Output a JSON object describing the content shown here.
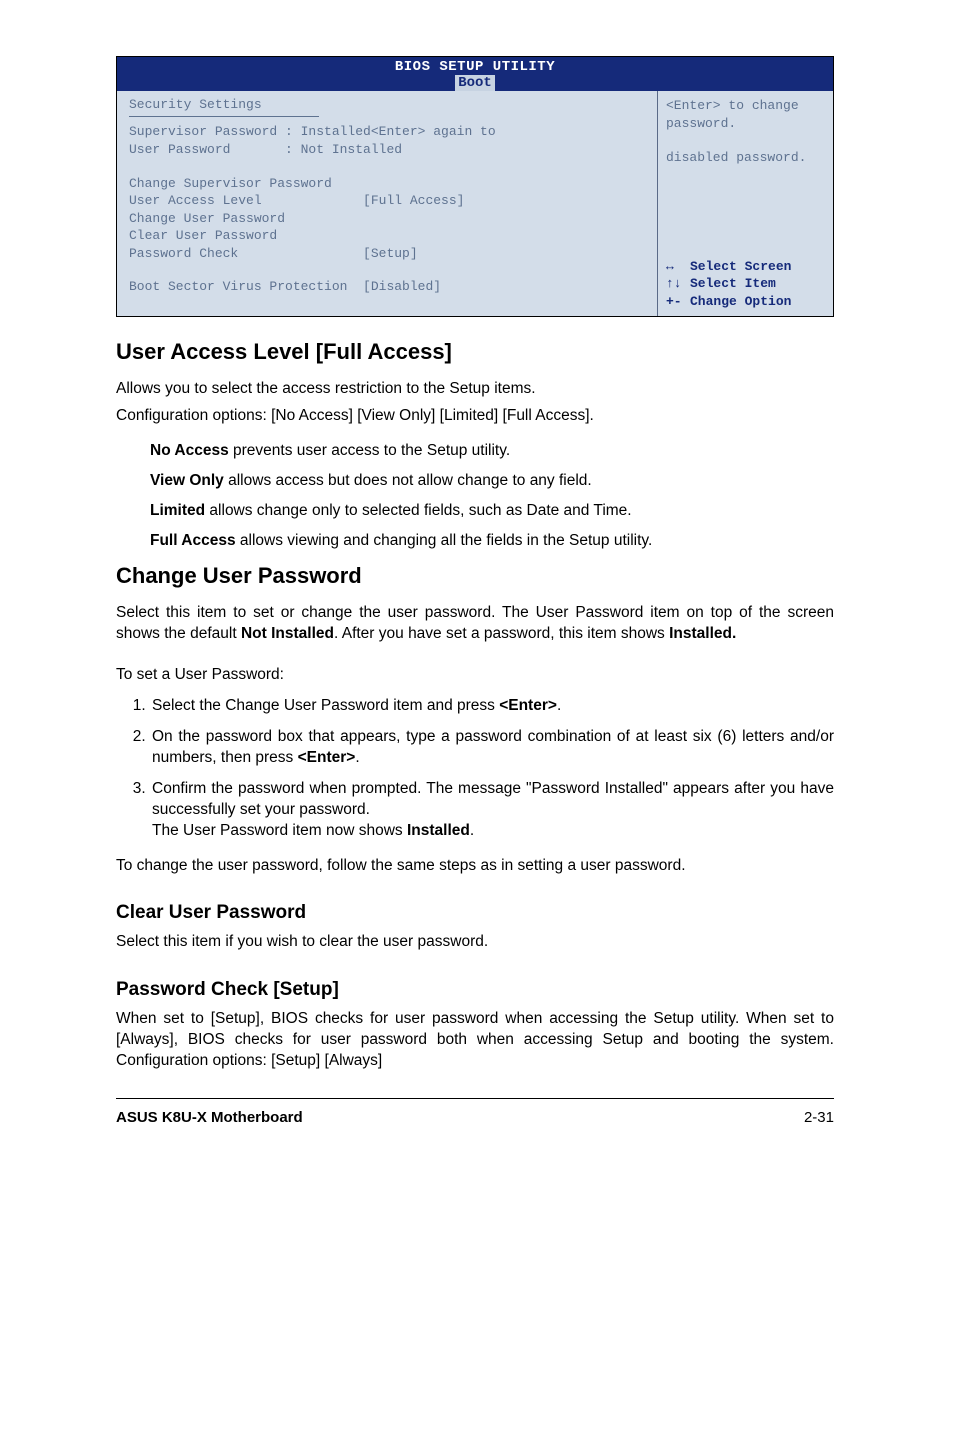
{
  "bios": {
    "title": "BIOS SETUP UTILITY",
    "tab": "Boot",
    "left": {
      "heading": "Security Settings",
      "supervisor_row": "Supervisor Password : Installed<Enter> again to",
      "user_pw_row": "User Password       : Not Installed",
      "items": {
        "change_sup": "Change Supervisor Password",
        "ual_label": "User Access Level",
        "ual_value": "[Full Access]",
        "change_user": "Change User Password",
        "clear_user": "Clear User Password",
        "pwcheck_label": "Password Check",
        "pwcheck_value": "[Setup]",
        "boot_label": "Boot Sector Virus Protection",
        "boot_value": "[Disabled]"
      }
    },
    "right": {
      "help1": "<Enter> to change",
      "help2": "password.",
      "help3": "disabled password.",
      "nav": {
        "l1": "Select Screen",
        "l2": "Select Item",
        "l3": "Change Option"
      },
      "arrows": {
        "lr": "↔",
        "ud": "↑↓",
        "pm": "+-"
      }
    }
  },
  "sections": {
    "ual": {
      "h": "User Access Level [Full Access]",
      "p1": "Allows you to select the access restriction to the Setup items.",
      "p2": "Configuration options: [No Access] [View Only] [Limited] [Full Access].",
      "no_access_b": "No Access",
      "no_access_t": " prevents user access to the Setup utility.",
      "view_only_b": "View Only",
      "view_only_t": " allows access but does not allow change to any field.",
      "limited_b": "Limited",
      "limited_t": " allows change only to selected fields, such as Date and Time.",
      "full_b": "Full Access",
      "full_t": " allows viewing and changing all the fields in the Setup utility."
    },
    "cup": {
      "h": "Change User Password",
      "p1a": "Select this item to set or change the user password. The User Password item on top of the screen shows the default ",
      "p1b": "Not Installed",
      "p1c": ". After you have set a password, this item shows ",
      "p1d": "Installed.",
      "p2": "To set a User Password:",
      "s1a": "Select the Change User Password item and press ",
      "s1b": "<Enter>",
      "s1c": ".",
      "s2a": "On the password box that appears, type a password combination of at least six (6) letters and/or numbers, then press ",
      "s2b": "<Enter>",
      "s2c": ".",
      "s3a": "Confirm the password when prompted. The message \"Password Installed\" appears after you have successfully set your password.",
      "s3b": "The User Password item now shows ",
      "s3c": "Installed",
      "s3d": ".",
      "p3": "To change the user password, follow the same steps as in setting a user password."
    },
    "clr": {
      "h": "Clear User Password",
      "p": "Select this item if you wish to clear the user password."
    },
    "pwc": {
      "h": "Password Check [Setup]",
      "p": "When set to [Setup], BIOS checks for user password when accessing the Setup utility. When set to [Always], BIOS checks for user password both when accessing Setup and booting the system. Configuration options: [Setup] [Always]"
    }
  },
  "footer": {
    "left": "ASUS K8U-X Motherboard",
    "right": "2-31"
  }
}
